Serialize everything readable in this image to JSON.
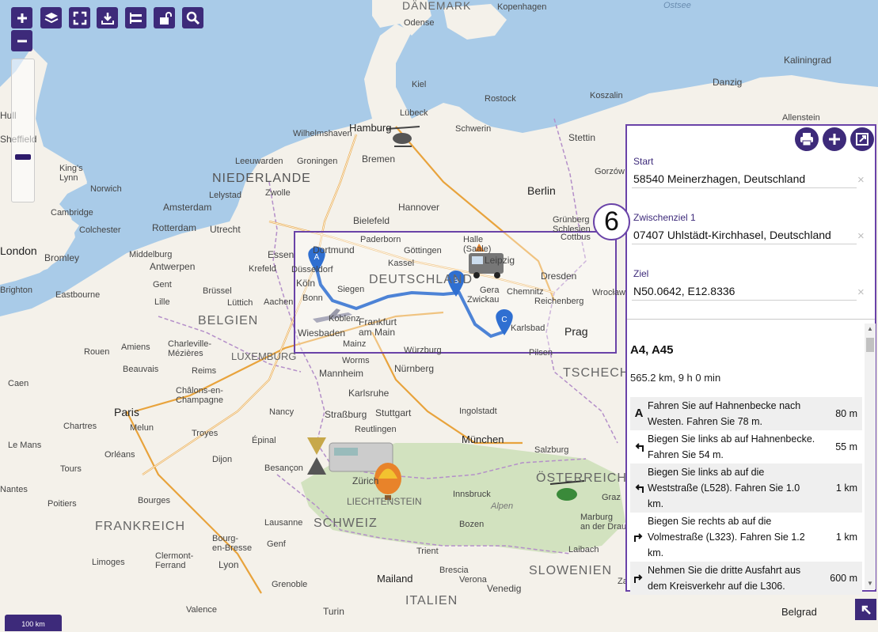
{
  "toolbar": {
    "buttons": [
      {
        "name": "zoom-in-button",
        "icon": "plus-icon"
      },
      {
        "name": "layers-button",
        "icon": "layers-icon"
      },
      {
        "name": "fullscreen-button",
        "icon": "fullscreen-icon"
      },
      {
        "name": "download-button",
        "icon": "download-icon"
      },
      {
        "name": "swap-button",
        "icon": "swap-icon"
      },
      {
        "name": "lock-button",
        "icon": "unlock-icon"
      },
      {
        "name": "search-button",
        "icon": "search-icon"
      }
    ],
    "zoom_out_icon": "minus-icon"
  },
  "scale_label": "100 km",
  "map": {
    "sea_color": "#a9cbe8",
    "land_color": "#f4f1ea",
    "labels": {
      "danemark": "DÄNEMARK",
      "kopenhagen": "Kopenhagen",
      "ostsee": "Ostsee",
      "odense": "Odense",
      "kaliningrad": "Kaliningrad",
      "danzig": "Danzig",
      "koszalin": "Koszalin",
      "allenstein": "Allenstein",
      "kiel": "Kiel",
      "rostock": "Rostock",
      "lubeck": "Lübeck",
      "hamburg": "Hamburg",
      "schwerin": "Schwerin",
      "stettin": "Stettin",
      "bremen": "Bremen",
      "wilhelmshaven": "Wilhelmshaven",
      "hull": "Hull",
      "sheffield": "Sheffield",
      "kingslynn": "King's\nLynn",
      "norwich": "Norwich",
      "niederlande": "NIEDERLANDE",
      "leeuwarden": "Leeuwarden",
      "groningen": "Groningen",
      "lelystad": "Lelystad",
      "zwolle": "Zwolle",
      "amsterdam": "Amsterdam",
      "hannover": "Hannover",
      "berlin": "Berlin",
      "cambridge": "Cambridge",
      "colchester": "Colchester",
      "rotterdam": "Rotterdam",
      "utrecht": "Utrecht",
      "bielefeld": "Bielefeld",
      "grunberg": "Grünberg\nSchlesien",
      "gorzow": "Gorzów",
      "cottbus": "Cottbus",
      "london": "London",
      "bromley": "Bromley",
      "middelburg": "Middelburg",
      "antwerpen": "Antwerpen",
      "essen": "Essen",
      "dortmund": "Dortmund",
      "paderborn": "Paderborn",
      "gottingen": "Göttingen",
      "halle": "Halle\n(Saale)",
      "leipzig": "Leipzig",
      "kassel": "Kassel",
      "gent": "Gent",
      "brussel": "Brüssel",
      "krefeld": "Krefeld",
      "dusseldorf": "Düsseldorf",
      "koln": "Köln",
      "bonn": "Bonn",
      "siegen": "Siegen",
      "deutschland": "DEUTSCHLAND",
      "dresden": "Dresden",
      "brighton": "Brighton",
      "eastbourne": "Eastbourne",
      "lille": "Lille",
      "aachen": "Aachen",
      "lutich": "Lüttich",
      "belgien": "BELGIEN",
      "gera": "Gera",
      "zwickau": "Zwickau",
      "chemnitz": "Chemnitz",
      "reichenberg": "Reichenberg",
      "wroclaw": "Wrocław",
      "wiesbaden": "Wiesbaden",
      "koblenz": "Koblenz",
      "frankfurt": "Frankfurt\nam Main",
      "mainz": "Mainz",
      "karlsbad": "Karlsbad",
      "prag": "Prag",
      "amiens": "Amiens",
      "charleville": "Charleville-\nMézières",
      "luxemburg": "LUXEMBURG",
      "wurzburg": "Würzburg",
      "pilsen": "Pilsen",
      "rouen": "Rouen",
      "beauvais": "Beauvais",
      "worms": "Worms",
      "mannheim": "Mannheim",
      "nurnberg": "Nürnberg",
      "tschechien": "TSCHECHIEN",
      "caen": "Caen",
      "reims": "Reims",
      "chalons": "Châlons-en-\nChampagne",
      "karlsruhe": "Karlsruhe",
      "paris": "Paris",
      "nancy": "Nancy",
      "strassburg": "Straßburg",
      "stuttgart": "Stuttgart",
      "ingolstadt": "Ingolstadt",
      "chartres": "Chartres",
      "melun": "Melun",
      "troyes": "Troyes",
      "reutlingen": "Reutlingen",
      "munchen": "München",
      "orleans": "Orléans",
      "epinal": "Épinal",
      "salzburg": "Salzburg",
      "le_mans": "Le Mans",
      "tours": "Tours",
      "dijon": "Dijon",
      "besancon": "Besançon",
      "zurich": "Zürich",
      "innsbruck": "Innsbruck",
      "osterreich": "ÖSTERREICH",
      "graz": "Graz",
      "liechtenstein": "LIECHTENSTEIN",
      "nantes": "Nantes",
      "poitiers": "Poitiers",
      "bourges": "Bourges",
      "lausanne": "Lausanne",
      "schweiz": "SCHWEIZ",
      "bolzano": "Bozen",
      "marburg": "Marburg\nan der Drau",
      "frankreich": "FRANKREICH",
      "bourg": "Bourg-\nen-Bresse",
      "genf": "Genf",
      "laibach": "Laibach",
      "limoges": "Limoges",
      "clermont": "Clermont-\nFerrand",
      "lyon": "Lyon",
      "slowenien": "SLOWENIEN",
      "trient": "Trient",
      "mailand": "Mailand",
      "brescia": "Brescia",
      "verona": "Verona",
      "venedig": "Venedig",
      "italien": "ITALIEN",
      "grenoble": "Grenoble",
      "valence": "Valence",
      "turin": "Turin",
      "belgrad": "Belgrad",
      "zagreb": "Zagreb",
      "alpen": "Alpen"
    },
    "route_markers": [
      "A",
      "B",
      "C"
    ]
  },
  "panel": {
    "print_icon": "print-icon",
    "add_icon": "plus-icon",
    "export_icon": "export-icon",
    "start_label": "Start",
    "start_value": "58540 Meinerzhagen, Deutschland",
    "via_label": "Zwischenziel 1",
    "via_value": "07407 Uhlstädt-Kirchhasel, Deutschland",
    "dest_label": "Ziel",
    "dest_value": "N50.0642, E12.8336",
    "clear_symbol": "×",
    "route_title": "A4, A45",
    "route_summary": "565.2 km, 9 h 0 min",
    "directions": [
      {
        "icon": "A",
        "text": "Fahren Sie auf Hahnenbecke nach Westen. Fahren Sie 78 m.",
        "dist": "80 m"
      },
      {
        "icon": "turn-left-icon",
        "text": "Biegen Sie links ab auf Hahnenbecke. Fahren Sie 54 m.",
        "dist": "55 m"
      },
      {
        "icon": "turn-left-icon",
        "text": "Biegen Sie links ab auf die Weststraße (L528). Fahren Sie 1.0 km.",
        "dist": "1 km"
      },
      {
        "icon": "turn-right-icon",
        "text": "Biegen Sie rechts ab auf die Volmestraße (L323). Fahren Sie 1.2 km.",
        "dist": "1 km"
      },
      {
        "icon": "turn-right-icon",
        "text": "Nehmen Sie die dritte Ausfahrt aus dem Kreisverkehr auf die L306.",
        "dist": "600 m"
      }
    ]
  },
  "step_marker": "6"
}
